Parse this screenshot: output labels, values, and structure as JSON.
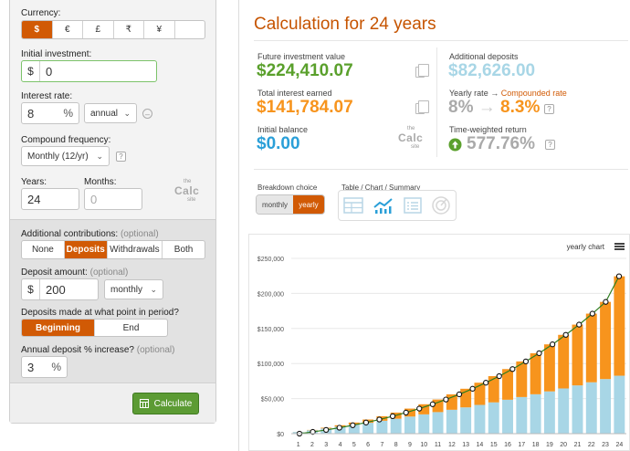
{
  "left": {
    "currency_label": "Currency:",
    "currencies": [
      "$",
      "€",
      "£",
      "₹",
      "¥",
      ""
    ],
    "initial_label": "Initial investment:",
    "initial_prefix": "$",
    "initial_value": "0",
    "rate_label": "Interest rate:",
    "rate_value": "8",
    "rate_suffix": "%",
    "rate_period": "annual",
    "compound_label": "Compound frequency:",
    "compound_value": "Monthly (12/yr)",
    "years_label": "Years:",
    "years_value": "24",
    "months_label": "Months:",
    "months_placeholder": "0",
    "logo_top": "the",
    "logo_main": "Calc",
    "logo_sub": "site",
    "contrib_label": "Additional contributions:",
    "contrib_optional": "(optional)",
    "contrib_options": [
      "None",
      "Deposits",
      "Withdrawals",
      "Both"
    ],
    "deposit_label": "Deposit amount:",
    "deposit_optional": "(optional)",
    "deposit_prefix": "$",
    "deposit_value": "200",
    "deposit_period": "monthly",
    "timing_label": "Deposits made at what point in period?",
    "timing_options": [
      "Beginning",
      "End"
    ],
    "increase_label": "Annual deposit % increase?",
    "increase_optional": "(optional)",
    "increase_value": "3",
    "increase_suffix": "%",
    "calculate_label": "Calculate"
  },
  "results": {
    "title": "Calculation for 24 years",
    "future_label": "Future investment value",
    "future_value": "$224,410.07",
    "interest_label": "Total interest earned",
    "interest_value": "$141,784.07",
    "initial_balance_label": "Initial balance",
    "initial_balance_value": "$0.00",
    "deposits_label": "Additional deposits",
    "deposits_value": "$82,626.00",
    "yearly_rate_label": "Yearly rate",
    "arrow": "→",
    "compounded_label": "Compounded rate",
    "rate_from": "8%",
    "rate_to": "8.3%",
    "twr_label": "Time-weighted return",
    "twr_value": "577.76%",
    "breakdown_label": "Breakdown choice",
    "breakdown_options": [
      "monthly",
      "yearly"
    ],
    "view_label": "Table / Chart / Summary",
    "chart_title": "yearly chart"
  },
  "colors": {
    "accent_orange": "#d15a05",
    "green": "#5aa02c",
    "deposits_blue": "#a8d6e6",
    "interest_orange": "#f7941d",
    "balance_blue": "#2a9fd8"
  },
  "chart_data": {
    "type": "bar",
    "stacked": true,
    "categories": [
      "1",
      "2",
      "3",
      "4",
      "5",
      "6",
      "7",
      "8",
      "9",
      "10",
      "11",
      "12",
      "13",
      "14",
      "15",
      "16",
      "17",
      "18",
      "19",
      "20",
      "21",
      "22",
      "23",
      "24"
    ],
    "series": [
      {
        "values": [
          2400,
          4872,
          7418,
          10040,
          12740,
          15522,
          18387,
          21338,
          24379,
          27509,
          30733,
          34054,
          37475,
          40999,
          44628,
          48366,
          52216,
          56182,
          60266,
          64473,
          68807,
          73270,
          77868,
          82626
        ]
      },
      {
        "values": [
          112,
          454,
          1062,
          1943,
          3122,
          4629,
          6484,
          8719,
          11355,
          14430,
          17968,
          22001,
          26555,
          31673,
          37387,
          43741,
          50778,
          58542,
          67078,
          76444,
          86693,
          97877,
          110060,
          141784
        ]
      }
    ],
    "line": {
      "values": [
        2512,
        5326,
        8480,
        11983,
        15862,
        20151,
        24871,
        30057,
        35734,
        41939,
        48701,
        56055,
        64030,
        72672,
        82015,
        92107,
        102994,
        114724,
        127344,
        140917,
        155500,
        171147,
        187928,
        224410
      ]
    },
    "ylim": [
      0,
      250000
    ],
    "yticks": [
      "$0",
      "$50,000",
      "$100,000",
      "$150,000",
      "$200,000",
      "$250,000"
    ],
    "grid": true,
    "legend": "none"
  }
}
